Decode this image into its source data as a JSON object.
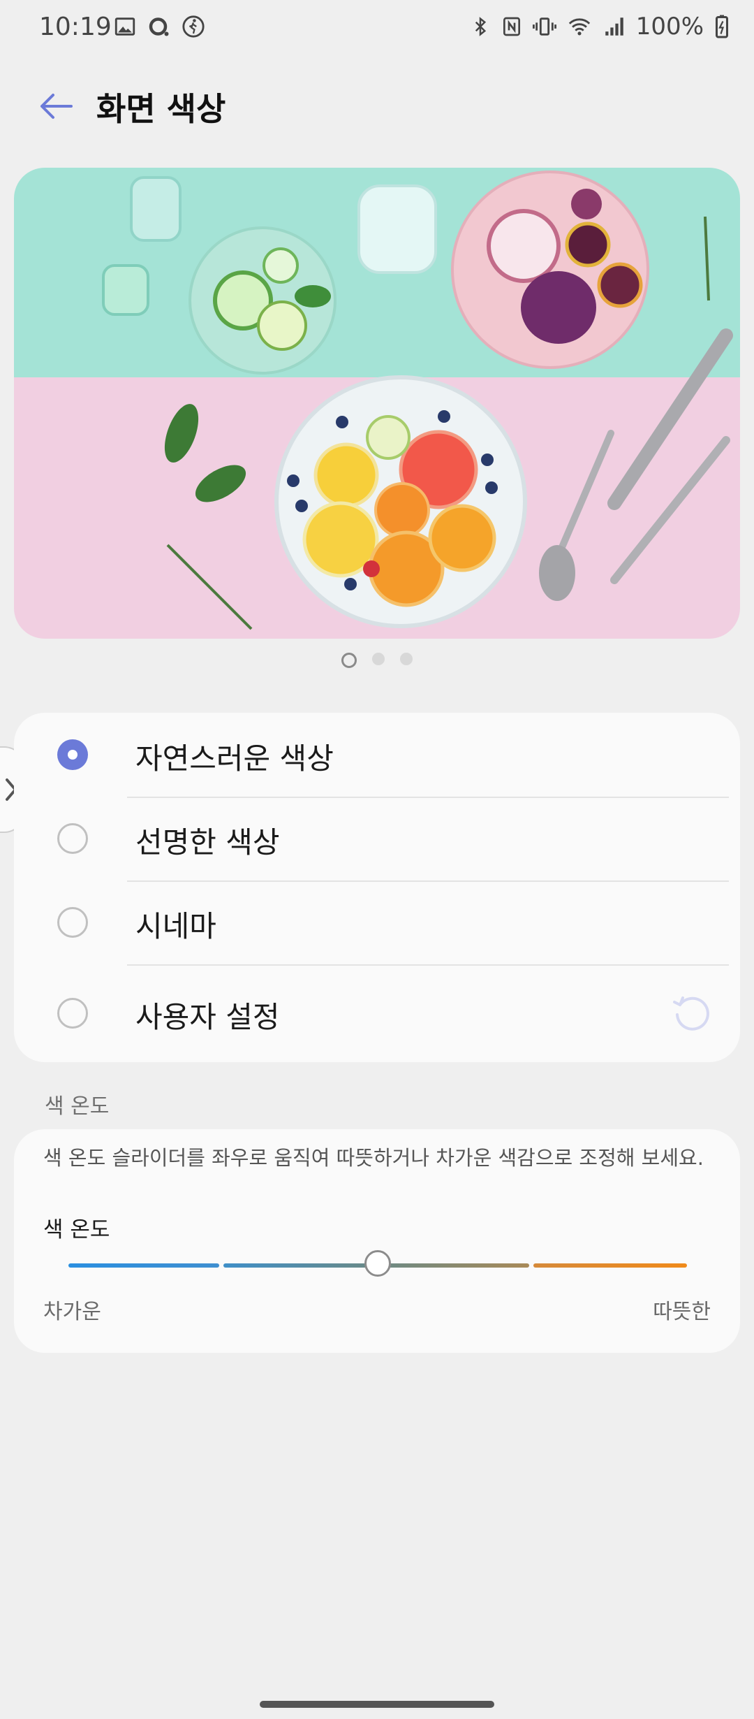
{
  "status_bar": {
    "time": "10:19",
    "battery": "100%",
    "left_icons": [
      "image-icon",
      "circle-icon",
      "walking-icon"
    ],
    "right_icons": [
      "bluetooth-icon",
      "nfc-icon",
      "vibrate-icon",
      "wifi-icon",
      "signal-icon",
      "battery-icon"
    ]
  },
  "header": {
    "title": "화면 색상",
    "back_icon": "back-arrow-icon"
  },
  "preview": {
    "page_count": 3,
    "current_page": 1
  },
  "modes": {
    "selected_index": 0,
    "items": [
      {
        "label": "자연스러운 색상"
      },
      {
        "label": "선명한 색상"
      },
      {
        "label": "시네마"
      },
      {
        "label": "사용자 설정"
      }
    ]
  },
  "temperature": {
    "section_title": "색 온도",
    "description": "색 온도 슬라이더를 좌우로 움직여 따뜻하거나 차가운 색감으로 조정해 보세요.",
    "slider_label": "색 온도",
    "min_label": "차가운",
    "max_label": "따뜻한",
    "value_fraction": 0.5,
    "colors": {
      "cold": "#2a8fe0",
      "mid": "#6b8a86",
      "warm": "#f08a1a"
    }
  },
  "accent_color": "#6b7ad8"
}
